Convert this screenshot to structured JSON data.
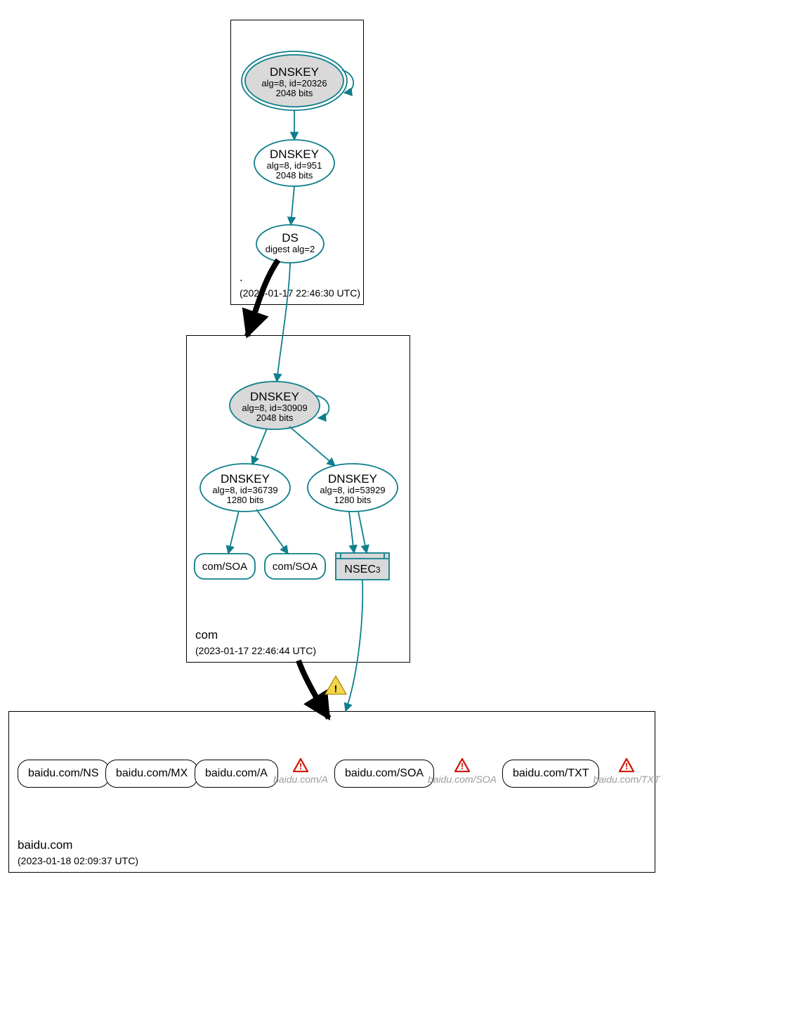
{
  "zones": {
    "root": {
      "label": ".",
      "timestamp": "(2023-01-17 22:46:30 UTC)",
      "nodes": {
        "ksk": {
          "title": "DNSKEY",
          "line2": "alg=8, id=20326",
          "line3": "2048 bits"
        },
        "zsk": {
          "title": "DNSKEY",
          "line2": "alg=8, id=951",
          "line3": "2048 bits"
        },
        "ds": {
          "title": "DS",
          "line2": "digest alg=2"
        }
      }
    },
    "com": {
      "label": "com",
      "timestamp": "(2023-01-17 22:46:44 UTC)",
      "nodes": {
        "ksk": {
          "title": "DNSKEY",
          "line2": "alg=8, id=30909",
          "line3": "2048 bits"
        },
        "zsk1": {
          "title": "DNSKEY",
          "line2": "alg=8, id=36739",
          "line3": "1280 bits"
        },
        "zsk2": {
          "title": "DNSKEY",
          "line2": "alg=8, id=53929",
          "line3": "1280 bits"
        },
        "soa1": {
          "label": "com/SOA"
        },
        "soa2": {
          "label": "com/SOA"
        },
        "nsec3": {
          "label": "NSEC3"
        }
      }
    },
    "baidu": {
      "label": "baidu.com",
      "timestamp": "(2023-01-18 02:09:37 UTC)",
      "records": {
        "ns": {
          "label": "baidu.com/NS"
        },
        "mx": {
          "label": "baidu.com/MX"
        },
        "a": {
          "label": "baidu.com/A"
        },
        "a_err": {
          "label": "baidu.com/A"
        },
        "soa": {
          "label": "baidu.com/SOA"
        },
        "soa_err": {
          "label": "baidu.com/SOA"
        },
        "txt": {
          "label": "baidu.com/TXT"
        },
        "txt_err": {
          "label": "baidu.com/TXT"
        }
      }
    }
  },
  "colors": {
    "teal": "#0e7e8c",
    "gray_fill": "#d9d9d9",
    "warn_yellow": "#f3d54e",
    "warn_border": "#a98f00",
    "err_red": "#d11a0a"
  }
}
